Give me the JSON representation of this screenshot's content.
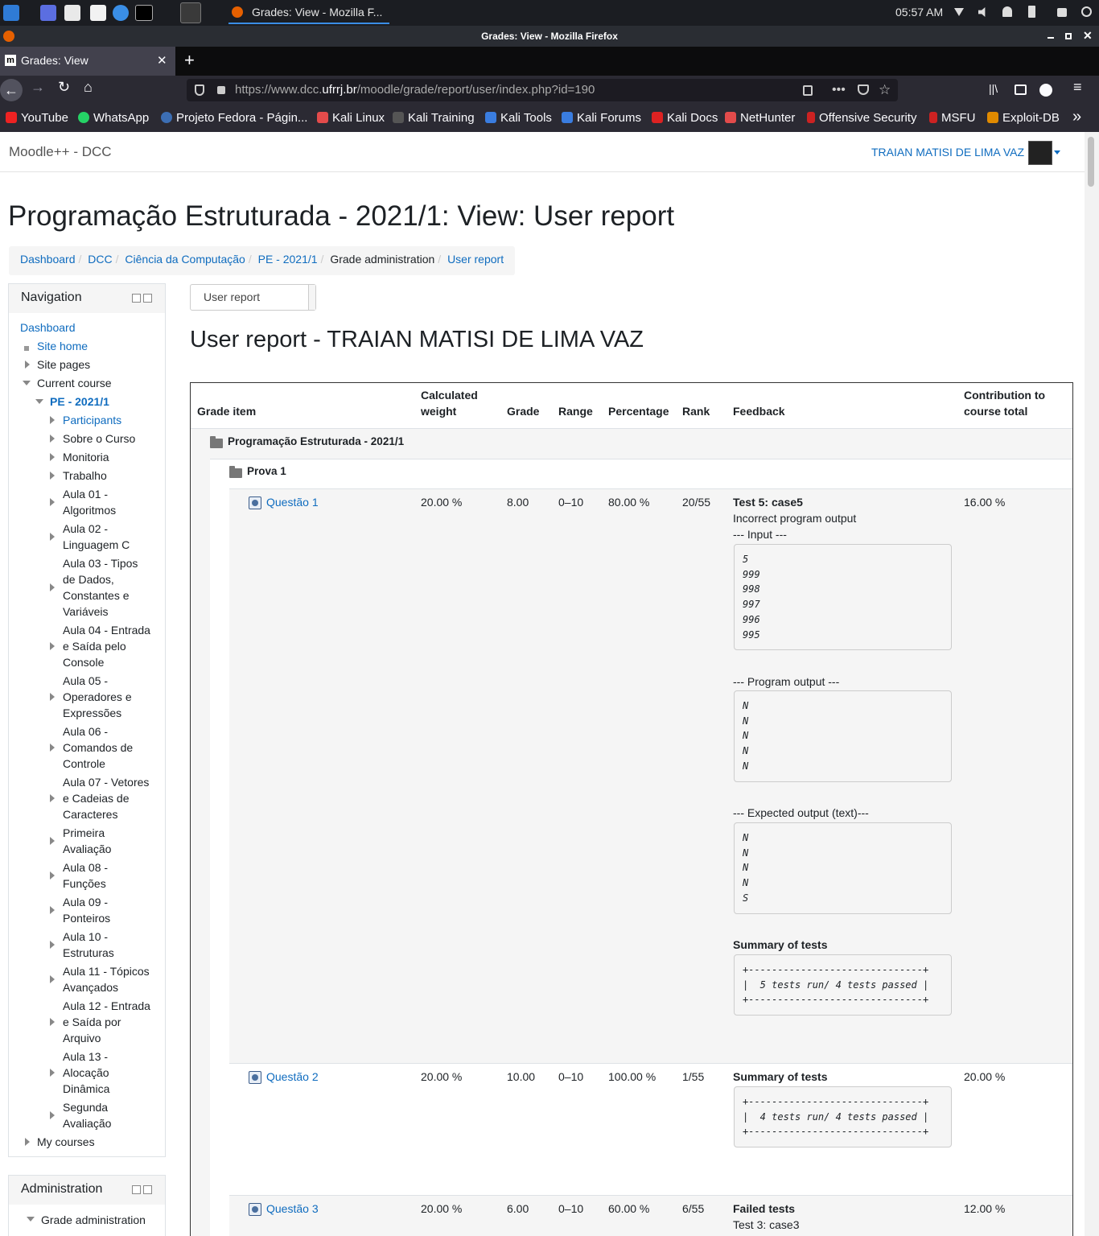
{
  "taskbar": {
    "time": "05:57 AM",
    "window_title": "Grades: View - Mozilla F..."
  },
  "firefox": {
    "titlebar": "Grades: View - Mozilla Firefox",
    "tab_title": "Grades: View",
    "url_prefix": "https://www.dcc.",
    "url_domain": "ufrrj.br",
    "url_path": "/moodle/grade/report/user/index.php?id=190",
    "bookmarks": [
      "YouTube",
      "WhatsApp",
      "Projeto Fedora - Págin...",
      "Kali Linux",
      "Kali Training",
      "Kali Tools",
      "Kali Forums",
      "Kali Docs",
      "NetHunter",
      "Offensive Security",
      "MSFU",
      "Exploit-DB"
    ]
  },
  "site": {
    "name": "Moodle++ - DCC",
    "user": "TRAIAN MATISI DE LIMA VAZ"
  },
  "page": {
    "heading": "Programação Estruturada - 2021/1: View: User report",
    "breadcrumbs": [
      "Dashboard",
      "DCC",
      "Ciência da Computação",
      "PE - 2021/1",
      "Grade administration",
      "User report"
    ],
    "report_select": "User report",
    "report_title": "User report - TRAIAN MATISI DE LIMA VAZ"
  },
  "navigation": {
    "title": "Navigation",
    "dashboard": "Dashboard",
    "site_home": "Site home",
    "site_pages": "Site pages",
    "current_course": "Current course",
    "course": "PE - 2021/1",
    "items": [
      "Participants",
      "Sobre o Curso",
      "Monitoria",
      "Trabalho",
      "Aula 01 - Algoritmos",
      "Aula 02 - Linguagem C",
      "Aula 03 - Tipos de Dados, Constantes e Variáveis",
      "Aula 04 - Entrada e Saída pelo Console",
      "Aula 05 - Operadores e Expressões",
      "Aula 06 - Comandos de Controle",
      "Aula 07 - Vetores e Cadeias de Caracteres",
      "Primeira Avaliação",
      "Aula 08 - Funções",
      "Aula 09 - Ponteiros",
      "Aula 10 - Estruturas",
      "Aula 11 - Tópicos Avançados",
      "Aula 12 - Entrada e Saída por Arquivo",
      "Aula 13 - Alocação Dinâmica",
      "Segunda Avaliação"
    ],
    "my_courses": "My courses"
  },
  "administration": {
    "title": "Administration",
    "grade_admin": "Grade administration"
  },
  "grades": {
    "headers": {
      "item": "Grade item",
      "weight": "Calculated weight",
      "grade": "Grade",
      "range": "Range",
      "percentage": "Percentage",
      "rank": "Rank",
      "feedback": "Feedback",
      "contribution": "Contribution to course total"
    },
    "course_category": "Programação Estruturada - 2021/1",
    "category": "Prova 1",
    "rows": [
      {
        "name": "Questão 1",
        "weight": "20.00 %",
        "grade": "8.00",
        "range": "0–10",
        "percentage": "80.00 %",
        "rank": "20/55",
        "contribution": "16.00 %",
        "fb_title": "Test 5: case5",
        "fb_line": "Incorrect program output",
        "input_label": "--- Input ---",
        "input": "5\n999\n998\n997\n996\n995",
        "output_label": "--- Program output ---",
        "output": "N\nN\nN\nN\nN",
        "expected_label": "--- Expected output (text)---",
        "expected": "N\nN\nN\nN\nS",
        "summary_label": "Summary of tests",
        "summary": "+------------------------------+\n|  5 tests run/ 4 tests passed |\n+------------------------------+"
      },
      {
        "name": "Questão 2",
        "weight": "20.00 %",
        "grade": "10.00",
        "range": "0–10",
        "percentage": "100.00 %",
        "rank": "1/55",
        "contribution": "20.00 %",
        "summary_label": "Summary of tests",
        "summary": "+------------------------------+\n|  4 tests run/ 4 tests passed |\n+------------------------------+"
      },
      {
        "name": "Questão 3",
        "weight": "20.00 %",
        "grade": "6.00",
        "range": "0–10",
        "percentage": "60.00 %",
        "rank": "6/55",
        "contribution": "12.00 %",
        "fb_title": "Failed tests",
        "fb_line": "Test 3: case3"
      }
    ]
  }
}
